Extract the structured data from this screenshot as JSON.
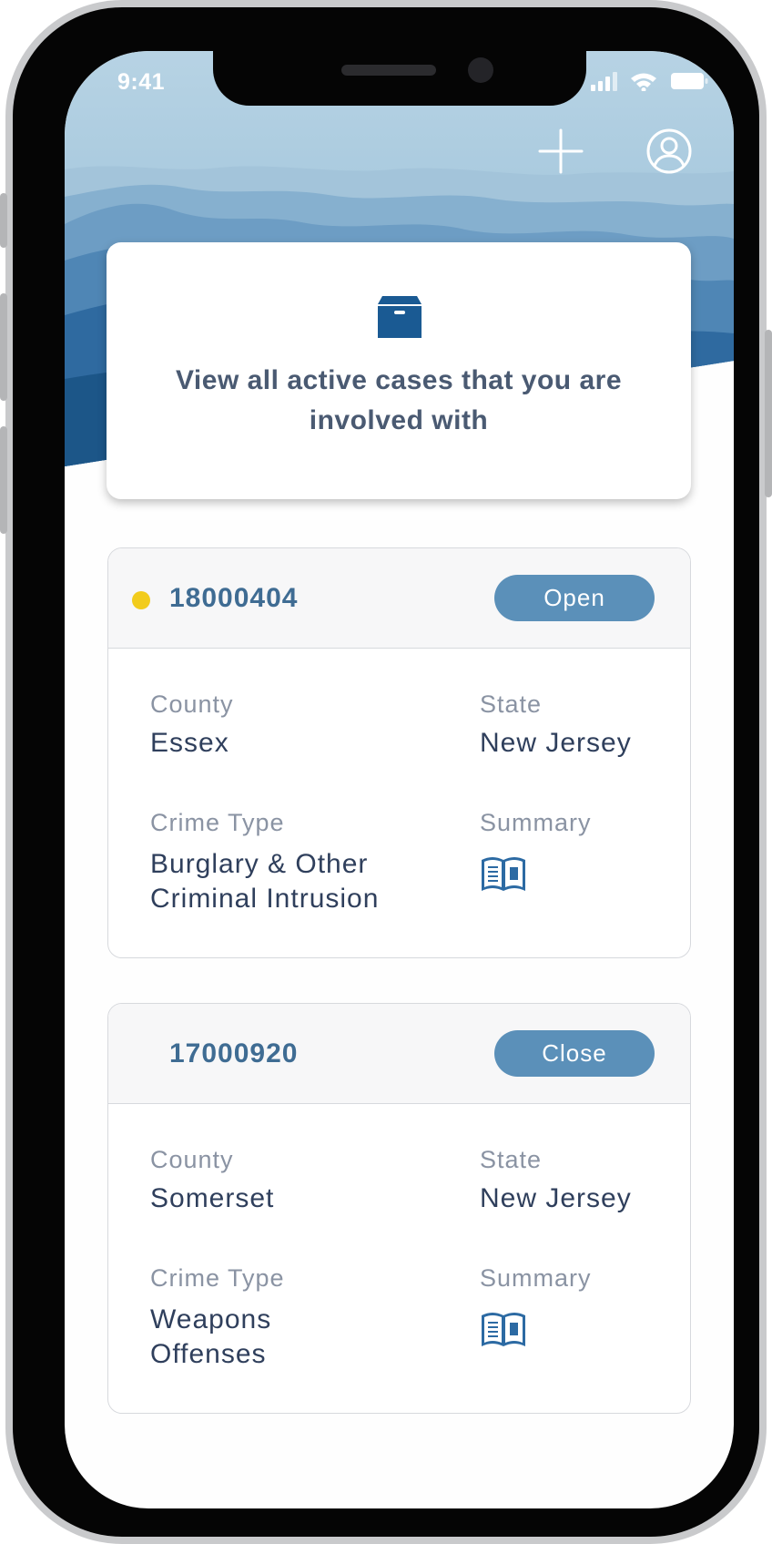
{
  "status_bar": {
    "time": "9:41"
  },
  "icons": {
    "signal": "signal-icon",
    "wifi": "wifi-icon",
    "battery": "battery-icon",
    "add": "plus-icon",
    "profile": "profile-icon",
    "intro": "archive-box-icon",
    "summary": "book-icon"
  },
  "colors": {
    "accent": "#5b90b9",
    "case_number": "#3f6c93",
    "status_dot": "#f2cc1c",
    "heading_text": "#4a5a72"
  },
  "intro": {
    "text": "View all active cases that you are involved with"
  },
  "cases": [
    {
      "number": "18000404",
      "status": "Open",
      "has_indicator": true,
      "county_label": "County",
      "county": "Essex",
      "state_label": "State",
      "state": "New Jersey",
      "crime_type_label": "Crime Type",
      "crime_type": "Burglary & Other Criminal Intrusion",
      "summary_label": "Summary"
    },
    {
      "number": "17000920",
      "status": "Close",
      "has_indicator": false,
      "county_label": "County",
      "county": "Somerset",
      "state_label": "State",
      "state": "New Jersey",
      "crime_type_label": "Crime Type",
      "crime_type": "Weapons Offenses",
      "summary_label": "Summary"
    }
  ]
}
